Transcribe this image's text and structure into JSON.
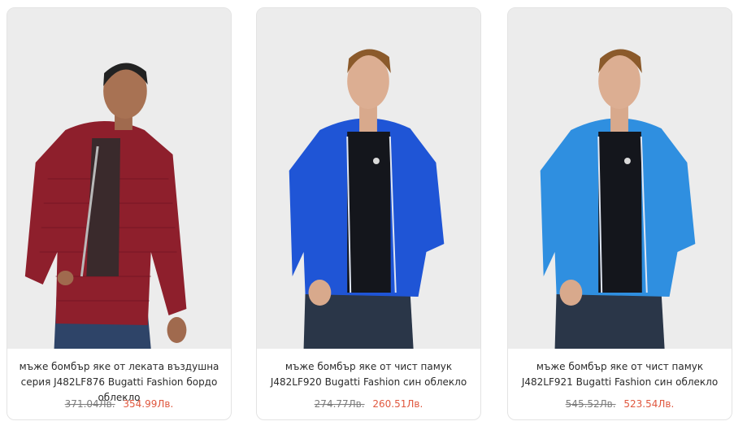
{
  "products": [
    {
      "title": "мъже бомбър яке от леката въздушна серия J482LF876 Bugatti Fashion бордо облекло",
      "old_price": "371.04Лв.",
      "new_price": "354.99Лв.",
      "jacket_color": "#8e1f2c",
      "image": "man-in-burgundy-puffer-jacket"
    },
    {
      "title": "мъже бомбър яке от чист памук J482LF920 Bugatti Fashion син облекло",
      "old_price": "274.77Лв.",
      "new_price": "260.51Лв.",
      "jacket_color": "#1f55d6",
      "image": "man-in-royal-blue-jacket"
    },
    {
      "title": "мъже бомбър яке от чист памук J482LF921 Bugatti Fashion син облекло",
      "old_price": "545.52Лв.",
      "new_price": "523.54Лв.",
      "jacket_color": "#2f8fe0",
      "image": "man-in-light-blue-jacket"
    }
  ],
  "colors": {
    "sale_price": "#e0583f",
    "old_price": "#7c7c7c",
    "card_border": "#e3e3e3"
  }
}
